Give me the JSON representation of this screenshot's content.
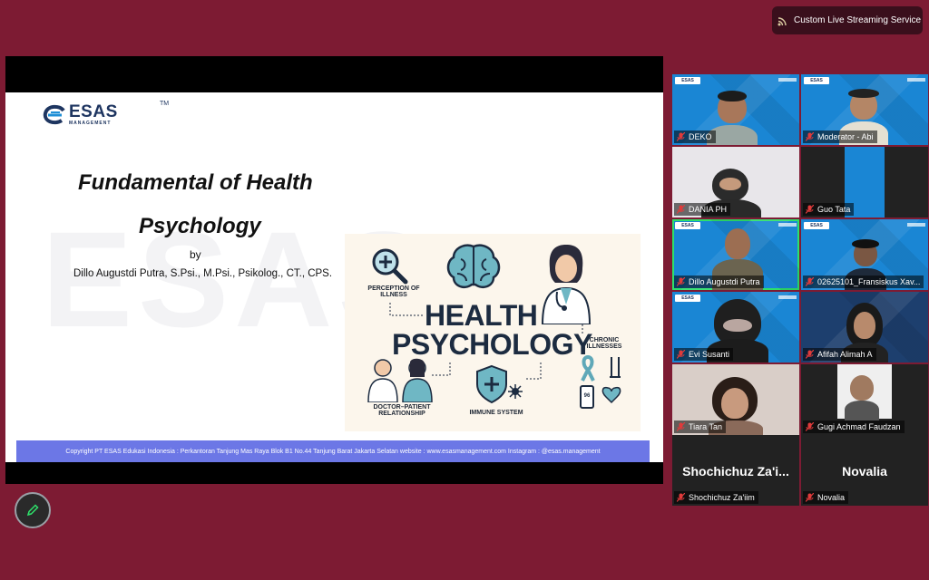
{
  "live_stream": {
    "label": "Custom Live Streaming Service",
    "icon": "broadcast-icon"
  },
  "slide": {
    "logo_word": "ESAS",
    "logo_sub": "MANAGEMENT",
    "logo_tm": "TM",
    "title_line1": "Fundamental of Health",
    "title_line2": "Psychology",
    "by": "by",
    "author": "Dillo Augustdi Putra, S.Psi., M.Psi., Psikolog., CT., CPS.",
    "watermark": "ESAS",
    "infographic": {
      "headline1": "HEALTH",
      "headline2": "PSYCHOLOGY",
      "perception": "PERCEPTION OF\nILLNESS",
      "chronic": "CHRONIC\nILLNESSES",
      "doctor": "DOCTOR–PATIENT\nRELATIONSHIP",
      "immune": "IMMUNE SYSTEM",
      "glucose": "96"
    },
    "footer": "Copyright PT ESAS Edukasi Indonesia : Perkantoran Tanjung Mas Raya Blok B1 No.44 Tanjung Barat Jakarta Selatan website : www.esasmanagement.com Instagram : @esas.management"
  },
  "annotate_button": {
    "icon": "pen-icon"
  },
  "participants": [
    {
      "name": "DEKO",
      "muted": true
    },
    {
      "name": "Moderator - Abi",
      "muted": true
    },
    {
      "name": "DANIA PH",
      "muted": true
    },
    {
      "name": "Guo Tata",
      "muted": true
    },
    {
      "name": "Dillo Augustdi Putra",
      "muted": true,
      "active_speaker": true
    },
    {
      "name": "02625101_Fransiskus Xav...",
      "muted": true
    },
    {
      "name": "Evi Susanti",
      "muted": true
    },
    {
      "name": "Afifah Alimah A",
      "muted": true
    },
    {
      "name": "Tiara Tan",
      "muted": true
    },
    {
      "name": "Gugi Achmad Faudzan",
      "muted": true
    },
    {
      "name": "Shochichuz Za'iim",
      "display": "Shochichuz Za'i...",
      "muted": true,
      "video_off": true
    },
    {
      "name": "Novalia",
      "display": "Novalia",
      "muted": true,
      "video_off": true
    }
  ],
  "tile_brand": "ESAS",
  "colors": {
    "background": "#7d1b33",
    "active_speaker": "#2ee06a",
    "footer_bar": "#6c77e6",
    "tile_blue": "#1a86d4"
  }
}
